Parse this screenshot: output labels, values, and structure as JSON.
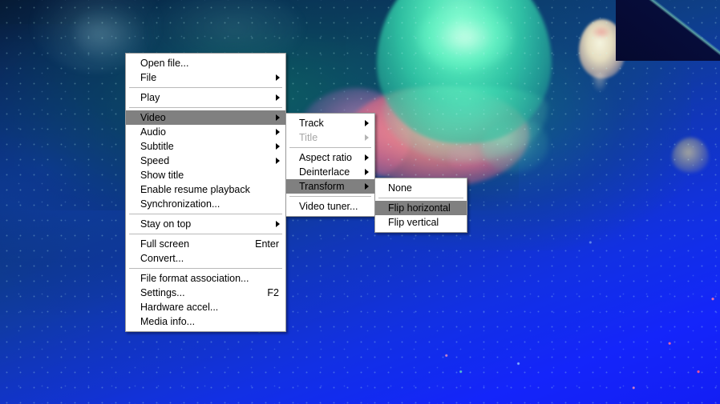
{
  "app": {
    "background_description": "underwater jellyfish video playback",
    "colors": {
      "menu_background": "#ffffff",
      "menu_border": "#9a9a9a",
      "menu_highlight": "#808080",
      "menu_text": "#000000",
      "menu_text_disabled": "#a6a6a6",
      "separator": "#b9b9b9",
      "water_deep_blue": "#1526f0",
      "water_dark_navy": "#071a33",
      "jelly_green": "#5aeebe",
      "jelly_pink": "#fc8c8c",
      "jelly_white": "#fcf0c8"
    }
  },
  "menus": {
    "main": {
      "name": "main-context-menu",
      "items": [
        {
          "type": "item",
          "label": "Open file...",
          "accel": "",
          "submenu": false,
          "disabled": false,
          "selected": false
        },
        {
          "type": "item",
          "label": "File",
          "accel": "",
          "submenu": true,
          "disabled": false,
          "selected": false
        },
        {
          "type": "separator"
        },
        {
          "type": "item",
          "label": "Play",
          "accel": "",
          "submenu": true,
          "disabled": false,
          "selected": false
        },
        {
          "type": "separator"
        },
        {
          "type": "item",
          "label": "Video",
          "accel": "",
          "submenu": true,
          "disabled": false,
          "selected": true
        },
        {
          "type": "item",
          "label": "Audio",
          "accel": "",
          "submenu": true,
          "disabled": false,
          "selected": false
        },
        {
          "type": "item",
          "label": "Subtitle",
          "accel": "",
          "submenu": true,
          "disabled": false,
          "selected": false
        },
        {
          "type": "item",
          "label": "Speed",
          "accel": "",
          "submenu": true,
          "disabled": false,
          "selected": false
        },
        {
          "type": "item",
          "label": "Show title",
          "accel": "",
          "submenu": false,
          "disabled": false,
          "selected": false
        },
        {
          "type": "item",
          "label": "Enable resume playback",
          "accel": "",
          "submenu": false,
          "disabled": false,
          "selected": false
        },
        {
          "type": "item",
          "label": "Synchronization...",
          "accel": "",
          "submenu": false,
          "disabled": false,
          "selected": false
        },
        {
          "type": "separator"
        },
        {
          "type": "item",
          "label": "Stay on top",
          "accel": "",
          "submenu": true,
          "disabled": false,
          "selected": false
        },
        {
          "type": "separator"
        },
        {
          "type": "item",
          "label": "Full screen",
          "accel": "Enter",
          "submenu": false,
          "disabled": false,
          "selected": false
        },
        {
          "type": "item",
          "label": "Convert...",
          "accel": "",
          "submenu": false,
          "disabled": false,
          "selected": false
        },
        {
          "type": "separator"
        },
        {
          "type": "item",
          "label": "File format association...",
          "accel": "",
          "submenu": false,
          "disabled": false,
          "selected": false
        },
        {
          "type": "item",
          "label": "Settings...",
          "accel": "F2",
          "submenu": false,
          "disabled": false,
          "selected": false
        },
        {
          "type": "item",
          "label": "Hardware accel...",
          "accel": "",
          "submenu": false,
          "disabled": false,
          "selected": false
        },
        {
          "type": "item",
          "label": "Media info...",
          "accel": "",
          "submenu": false,
          "disabled": false,
          "selected": false
        }
      ]
    },
    "video": {
      "name": "video-submenu",
      "items": [
        {
          "type": "item",
          "label": "Track",
          "accel": "",
          "submenu": true,
          "disabled": false,
          "selected": false
        },
        {
          "type": "item",
          "label": "Title",
          "accel": "",
          "submenu": true,
          "disabled": true,
          "selected": false
        },
        {
          "type": "separator"
        },
        {
          "type": "item",
          "label": "Aspect ratio",
          "accel": "",
          "submenu": true,
          "disabled": false,
          "selected": false
        },
        {
          "type": "item",
          "label": "Deinterlace",
          "accel": "",
          "submenu": true,
          "disabled": false,
          "selected": false
        },
        {
          "type": "item",
          "label": "Transform",
          "accel": "",
          "submenu": true,
          "disabled": false,
          "selected": true
        },
        {
          "type": "separator"
        },
        {
          "type": "item",
          "label": "Video tuner...",
          "accel": "",
          "submenu": false,
          "disabled": false,
          "selected": false
        }
      ]
    },
    "transform": {
      "name": "transform-submenu",
      "items": [
        {
          "type": "item",
          "label": "None",
          "accel": "",
          "submenu": false,
          "disabled": false,
          "selected": false
        },
        {
          "type": "separator"
        },
        {
          "type": "item",
          "label": "Flip horizontal",
          "accel": "",
          "submenu": false,
          "disabled": false,
          "selected": true
        },
        {
          "type": "item",
          "label": "Flip vertical",
          "accel": "",
          "submenu": false,
          "disabled": false,
          "selected": false
        }
      ]
    }
  }
}
